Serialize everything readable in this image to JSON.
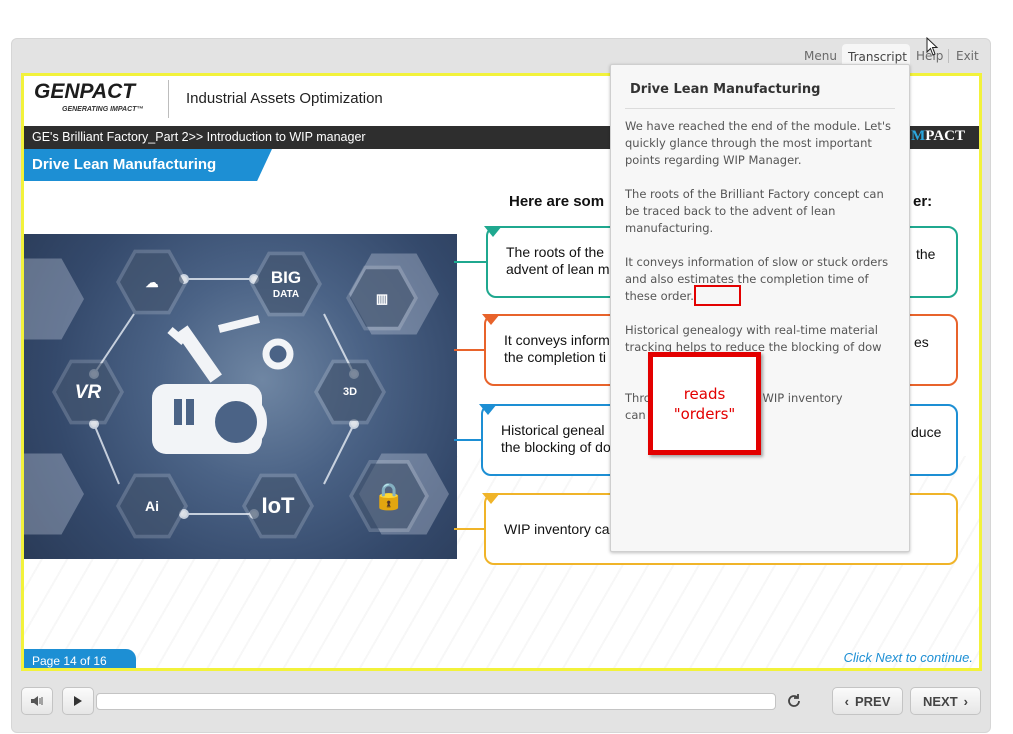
{
  "topnav": {
    "menu": "Menu",
    "transcript": "Transcript",
    "help": "Help",
    "exit": "Exit"
  },
  "header": {
    "logo": "GENPACT",
    "logo_tagline": "GENERATING IMPACT™",
    "course_title": "Industrial Assets Optimization",
    "breadcrumb": "GE's Brilliant Factory_Part 2>> Introduction to WIP manager",
    "impact_brand_m": "M",
    "impact_brand": "PACT"
  },
  "slide": {
    "title": "Drive Lean Manufacturing",
    "heading": "Here are som",
    "heading_tail": "er:",
    "hero_icons": [
      "BIG",
      "DATA",
      "IoT",
      "VR",
      "Ai",
      "3D"
    ],
    "cards": [
      {
        "text_line1": "The roots of the",
        "text_line2": "advent of lean m",
        "tail": "the",
        "color": "#1fa88f"
      },
      {
        "text_line1": "It conveys inform",
        "text_line2": "the completion ti",
        "tail": "es",
        "color": "#e8632b"
      },
      {
        "text_line1": "Historical geneal",
        "text_line2": "the blocking of do",
        "tail": "duce",
        "color": "#1d8fd4"
      },
      {
        "text_line1": "WIP inventory ca",
        "text_line2": "",
        "tail": "",
        "color": "#f0b429"
      }
    ],
    "page_label": "Page 14 of 16",
    "next_hint": "Click  Next to continue."
  },
  "transcript": {
    "title": "Drive Lean Manufacturing",
    "para1": "We have reached the end of the module. Let's quickly glance through the most important points regarding WIP Manager.",
    "para2": "The roots of the Brilliant Factory concept can be traced back to the advent of lean manufacturing.",
    "para3": "It conveys information of slow or stuck orders and also estimates the completion time of these order.",
    "para4": "Historical genealogy with real-time material tracking helps to reduce the blocking of dow",
    "para5_a": "Thro",
    "para5_b": "ons, WIP inventory",
    "para5_c": "can"
  },
  "annotation": {
    "line1": "reads",
    "line2": "\"orders\"",
    "color": "#e30000"
  },
  "controls": {
    "prev": "PREV",
    "next": "NEXT"
  }
}
